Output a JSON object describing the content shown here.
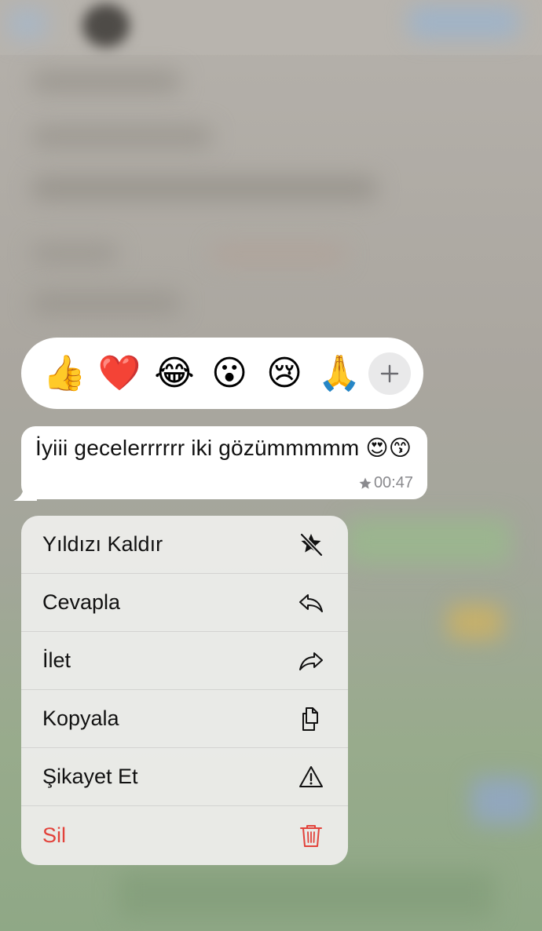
{
  "reactions": {
    "emojis": [
      "👍",
      "❤️",
      "😂",
      "😮",
      "😢",
      "🙏"
    ],
    "more_icon": "plus-icon"
  },
  "message": {
    "text": "İyiii gecelerrrrrr iki gözümmmmm 😍😙",
    "time": "00:47",
    "starred_icon": "star-icon"
  },
  "menu": {
    "items": [
      {
        "label": "Yıldızı Kaldır",
        "icon": "unstar-icon"
      },
      {
        "label": "Cevapla",
        "icon": "reply-icon"
      },
      {
        "label": "İlet",
        "icon": "forward-icon"
      },
      {
        "label": "Kopyala",
        "icon": "copy-icon"
      },
      {
        "label": "Şikayet Et",
        "icon": "warning-icon"
      },
      {
        "label": "Sil",
        "icon": "trash-icon"
      }
    ]
  },
  "colors": {
    "danger": "#e2423a",
    "bubble": "#ffffff",
    "menu_bg": "#ececea"
  }
}
